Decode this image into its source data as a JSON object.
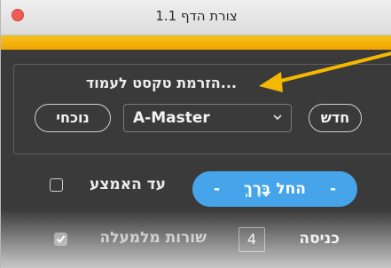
{
  "window": {
    "title": "צורת הדף 1.1"
  },
  "panel": {
    "label": "...הזרמת טקסט לעמוד",
    "current_button": "נוכחי",
    "master_select": {
      "value": "A-Master"
    },
    "new_button": "חדש"
  },
  "options": {
    "until_middle_label": "עד האמצע",
    "until_middle_checked": false,
    "start_button": "החל בָּרֶךְ",
    "start_button_dash": "-"
  },
  "indent": {
    "label": "כניסה",
    "value": "4",
    "lines_above_label": "שורות מלמעלה",
    "lines_above_checked": true
  },
  "colors": {
    "accent": "#46a5ea",
    "gold": "#f2a300",
    "arrow": "#f5b800",
    "background": "#3a3a3a"
  }
}
